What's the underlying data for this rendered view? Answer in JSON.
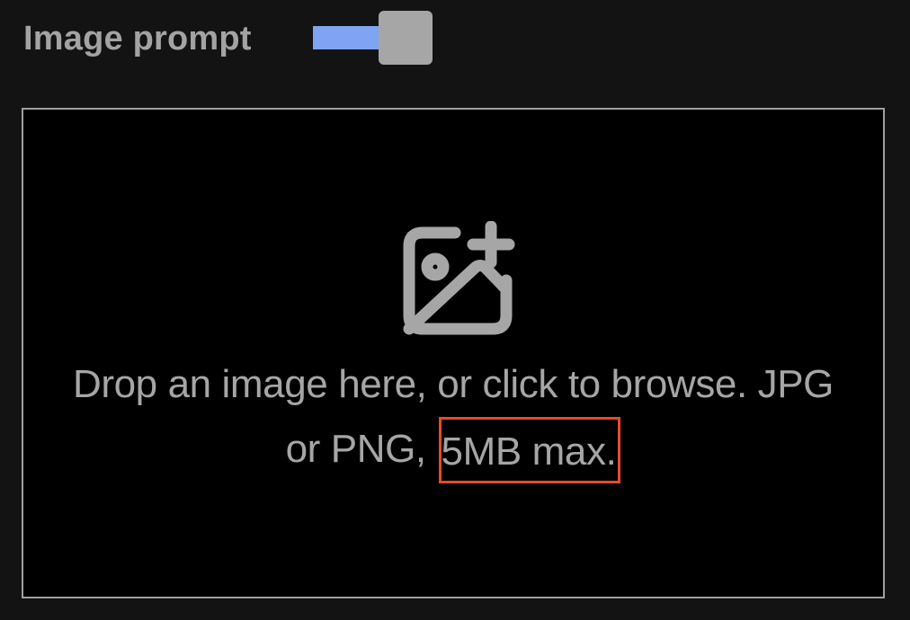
{
  "header": {
    "title": "Image prompt",
    "toggle": {
      "state": "on",
      "track_color": "#7ea4f2",
      "thumb_color": "#a6a6a6"
    }
  },
  "dropzone": {
    "icon": "image-plus-icon",
    "text_line1": "Drop an image here, or click to browse. JPG",
    "text_line2_prefix": "or PNG, ",
    "text_line2_highlight": "5MB max.",
    "highlight_color": "#e64a2e"
  }
}
